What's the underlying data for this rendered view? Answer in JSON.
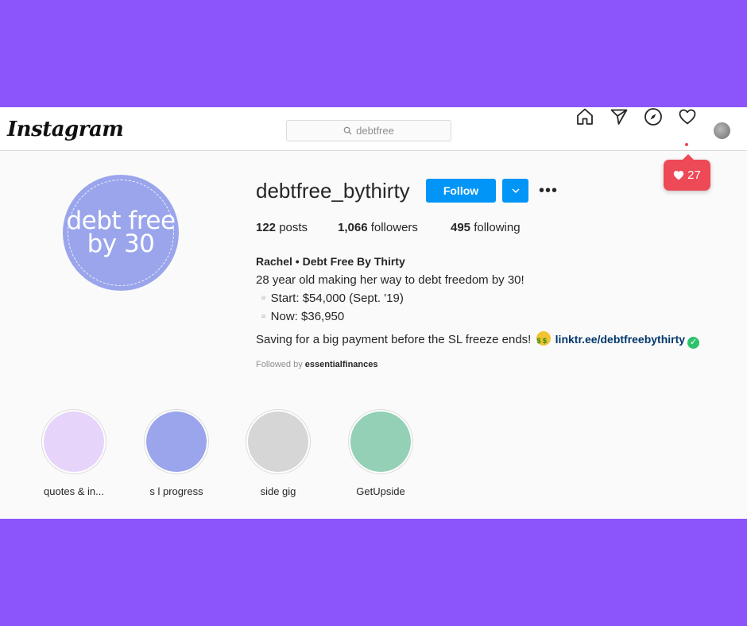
{
  "app": {
    "logo_text": "Instagram"
  },
  "search": {
    "value": "debtfree"
  },
  "nav": {
    "icons": [
      "home-icon",
      "direct-send-icon",
      "explore-compass-icon",
      "activity-heart-icon",
      "profile-avatar"
    ]
  },
  "notification": {
    "count": "27",
    "color": "#ed4956"
  },
  "profile": {
    "picture_text_line1": "debt free",
    "picture_text_line2": "by 30",
    "username": "debtfree_bythirty",
    "follow_label": "Follow",
    "more_label": "•••",
    "stats": {
      "posts_count": "122",
      "posts_label": "posts",
      "followers_count": "1,066",
      "followers_label": "followers",
      "following_count": "495",
      "following_label": "following"
    },
    "bio": {
      "name": "Rachel • Debt Free By Thirty",
      "line1": "28 year old making her way to debt freedom by 30!",
      "line2": "▫️Start: $54,000 (Sept. '19)",
      "line3": "▫️Now: $36,950",
      "line4": "Saving for a big payment before the SL freeze ends!",
      "link": "linktr.ee/debtfreebythirty"
    },
    "followed_by_prefix": "Followed by",
    "followed_by_user": "essentialfinances"
  },
  "highlights": [
    {
      "label": "quotes & in...",
      "color": "#e6d4fb"
    },
    {
      "label": "s l progress",
      "color": "#9aa5ec"
    },
    {
      "label": "side gig",
      "color": "#d6d6d6"
    },
    {
      "label": "GetUpside",
      "color": "#94d0b6"
    }
  ],
  "colors": {
    "background": "#8b55fb",
    "accent": "#0095f6",
    "link": "#00376b"
  }
}
